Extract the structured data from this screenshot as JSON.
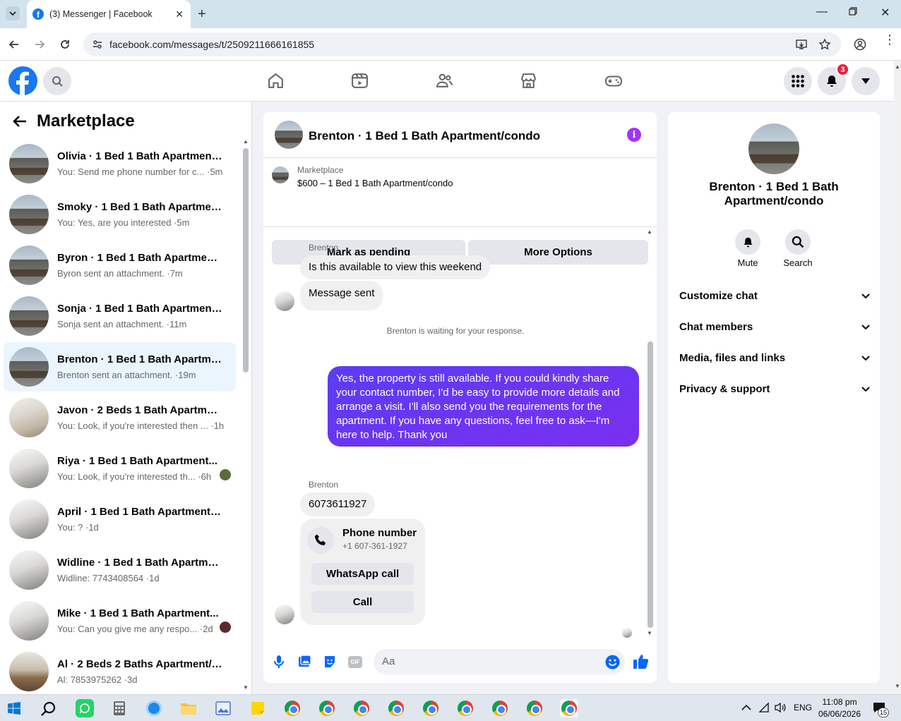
{
  "browser": {
    "tab_title": "(3) Messenger | Facebook",
    "url": "facebook.com/messages/t/2509211666161855"
  },
  "fb": {
    "notification_count": "3"
  },
  "sidebar": {
    "title": "Marketplace",
    "conversations": [
      {
        "title": "Olivia · 1 Bed 1 Bath Apartment/...",
        "snippet": "You: Send me phone number for c... ·5m",
        "avatar": "house"
      },
      {
        "title": "Smoky · 1 Bed 1 Bath Apartment...",
        "snippet": "You: Yes, are you interested ·5m",
        "avatar": "house"
      },
      {
        "title": "Byron · 1 Bed 1 Bath Apartment/...",
        "snippet": "Byron sent an attachment. ·7m",
        "avatar": "house"
      },
      {
        "title": "Sonja · 1 Bed 1 Bath Apartment/...",
        "snippet": "Sonja sent an attachment. ·11m",
        "avatar": "house"
      },
      {
        "title": "Brenton · 1 Bed 1 Bath Apartmen...",
        "snippet": "Brenton sent an attachment. ·19m",
        "avatar": "house",
        "active": true
      },
      {
        "title": "Javon · 2 Beds 1 Bath Apartment...",
        "snippet": "You: Look, if you're interested then ... ·1h",
        "avatar": "room"
      },
      {
        "title": "Riya · 1 Bed 1 Bath Apartment...",
        "snippet": "You: Look, if you're interested th... ·6h",
        "avatar": "white",
        "seen": "#5a6b3a"
      },
      {
        "title": "April · 1 Bed 1 Bath Apartment/c...",
        "snippet": "You: ? ·1d",
        "avatar": "white"
      },
      {
        "title": "Widline · 1 Bed 1 Bath Apartmen...",
        "snippet": "Widline: 7743408564 ·1d",
        "avatar": "white"
      },
      {
        "title": "Mike · 1 Bed 1 Bath Apartment...",
        "snippet": "You: Can you give me any respo... ·2d",
        "avatar": "white",
        "seen": "#5a2a2a"
      },
      {
        "title": "Al · 2 Beds 2 Baths Apartment/c...",
        "snippet": "Al: 7853975262 ·3d",
        "avatar": "kitchen"
      }
    ]
  },
  "chat": {
    "header_title": "Brenton · 1 Bed 1 Bath Apartment/condo",
    "listing_source": "Marketplace",
    "listing_title": "$600 – 1 Bed 1 Bath Apartment/condo",
    "mark_pending": "Mark as pending",
    "more_options": "More Options",
    "sender_name": "Brenton",
    "msg1": "Is this available to view this weekend",
    "msg2": "Message sent",
    "waiting_notice": "Brenton is waiting for your response.",
    "outgoing": "Yes, the property is still available. If you could kindly share your contact number, I'd be easy to provide more details and arrange a visit. I'll also send you the requirements for the apartment. If you have any questions, feel free to ask—I'm here to help. Thank you",
    "sender_name2": "Brenton",
    "msg3": "6073611927",
    "phone_card_title": "Phone number",
    "phone_card_number": "+1 607-361-1927",
    "whatsapp_call": "WhatsApp call",
    "call": "Call",
    "composer_placeholder": "Aa"
  },
  "details": {
    "name": "Brenton · 1 Bed 1 Bath Apartment/condo",
    "mute": "Mute",
    "search": "Search",
    "sections": [
      "Customize chat",
      "Chat members",
      "Media, files and links",
      "Privacy & support"
    ]
  },
  "taskbar": {
    "lang": "ENG",
    "time": "11:08 pm",
    "date": "06/06/2026",
    "notif_count": "15"
  },
  "colors": {
    "fb_blue": "#1877f2",
    "messenger_purple": "#7b2ff0",
    "active_row": "#ebf5ff"
  }
}
